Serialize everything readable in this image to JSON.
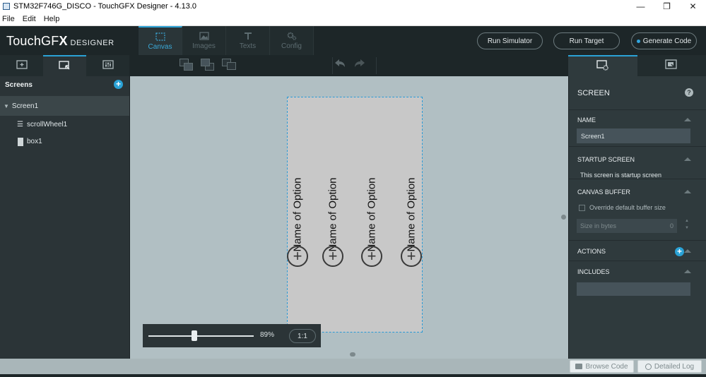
{
  "window": {
    "title": "STM32F746G_DISCO - TouchGFX Designer - 4.13.0",
    "controls": [
      "—",
      "❐",
      "✕"
    ]
  },
  "menu": [
    "File",
    "Edit",
    "Help"
  ],
  "logo": {
    "touch": "TouchGF",
    "gfx": "X",
    "designer": "DESIGNER"
  },
  "main_tabs": [
    {
      "label": "Canvas",
      "icon": "canvas-icon",
      "active": true
    },
    {
      "label": "Images",
      "icon": "images-icon",
      "active": false
    },
    {
      "label": "Texts",
      "icon": "texts-icon",
      "active": false
    },
    {
      "label": "Config",
      "icon": "config-icon",
      "active": false
    }
  ],
  "header_buttons": {
    "run_simulator": "Run Simulator",
    "run_target": "Run Target",
    "generate_code": "Generate Code"
  },
  "left_panel": {
    "title": "Screens",
    "screen": "Screen1",
    "widgets": [
      "scrollWheel1",
      "box1"
    ]
  },
  "canvas": {
    "options": [
      "Name of Option",
      "Name of Option",
      "Name of Option",
      "Name of Option"
    ],
    "zoom": {
      "value": "89%",
      "reset": "1:1",
      "level": 0.89
    }
  },
  "properties": {
    "title": "SCREEN",
    "name_label": "NAME",
    "name_value": "Screen1",
    "startup_label": "STARTUP SCREEN",
    "startup_text": "This screen is startup screen",
    "canvas_buffer_label": "CANVAS BUFFER",
    "override_label": "Override default buffer size",
    "size_placeholder": "Size in bytes",
    "size_value": "0",
    "actions_label": "ACTIONS",
    "includes_label": "INCLUDES"
  },
  "bottom": {
    "browse_code": "Browse Code",
    "detailed_log": "Detailed Log"
  },
  "colors": {
    "accent": "#2aa2d6",
    "canvas_bg": "#b1bfc3",
    "screen_bg": "#c8c8c8",
    "panel": "#2b3437"
  }
}
